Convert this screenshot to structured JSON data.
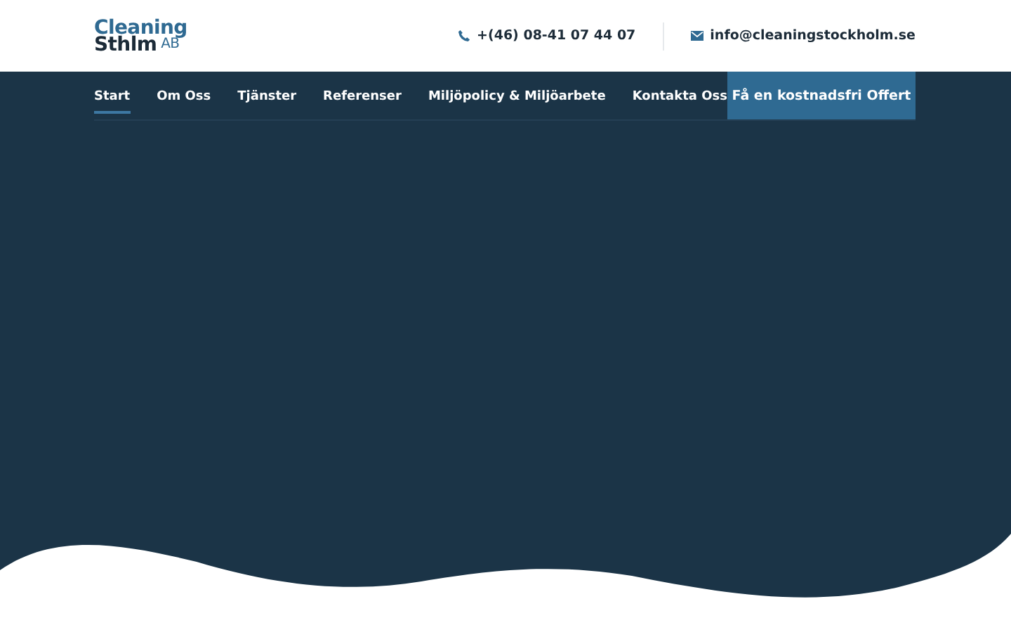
{
  "logo": {
    "top": "Cleaning",
    "bottom": "Sthlm",
    "suffix": "AB"
  },
  "contacts": [
    {
      "kind": "phone",
      "text": "+(46) 08-41 07 44 07"
    },
    {
      "kind": "email",
      "text": "info@cleaningstockholm.se"
    }
  ],
  "nav": [
    {
      "label": "Start",
      "selected": true
    },
    {
      "label": "Om Oss",
      "selected": false
    },
    {
      "label": "Tjänster",
      "selected": false
    },
    {
      "label": "Referenser",
      "selected": false
    },
    {
      "label": "Miljöpolicy & Miljöarbete",
      "selected": false
    },
    {
      "label": "Kontakta Oss",
      "selected": false
    }
  ],
  "cta": "Få en kostnadsfri Offert"
}
